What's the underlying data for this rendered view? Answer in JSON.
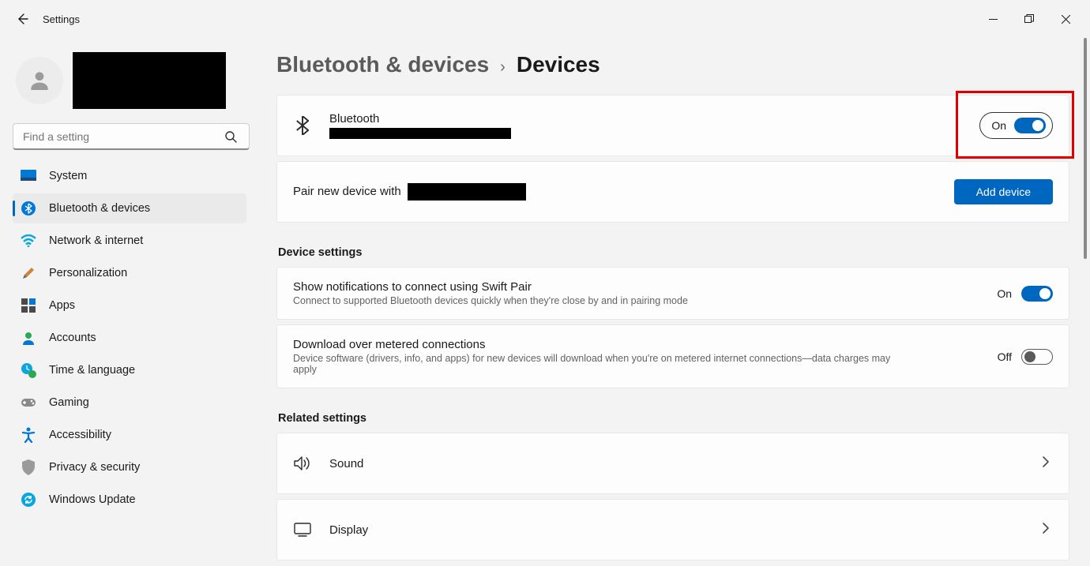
{
  "window": {
    "title": "Settings"
  },
  "search": {
    "placeholder": "Find a setting"
  },
  "nav": {
    "items": [
      {
        "label": "System"
      },
      {
        "label": "Bluetooth & devices"
      },
      {
        "label": "Network & internet"
      },
      {
        "label": "Personalization"
      },
      {
        "label": "Apps"
      },
      {
        "label": "Accounts"
      },
      {
        "label": "Time & language"
      },
      {
        "label": "Gaming"
      },
      {
        "label": "Accessibility"
      },
      {
        "label": "Privacy & security"
      },
      {
        "label": "Windows Update"
      }
    ],
    "active_index": 1
  },
  "breadcrumb": {
    "parent": "Bluetooth & devices",
    "current": "Devices"
  },
  "bluetooth_card": {
    "title": "Bluetooth",
    "toggle_label": "On",
    "toggle_on": true
  },
  "pair_card": {
    "prefix": "Pair new device with",
    "button": "Add device"
  },
  "sections": {
    "device_settings": "Device settings",
    "related_settings": "Related settings"
  },
  "swift_pair": {
    "title": "Show notifications to connect using Swift Pair",
    "desc": "Connect to supported Bluetooth devices quickly when they're close by and in pairing mode",
    "toggle_label": "On",
    "toggle_on": true
  },
  "metered": {
    "title": "Download over metered connections",
    "desc": "Device software (drivers, info, and apps) for new devices will download when you're on metered internet connections—data charges may apply",
    "toggle_label": "Off",
    "toggle_on": false
  },
  "related": {
    "sound": "Sound",
    "display": "Display"
  }
}
